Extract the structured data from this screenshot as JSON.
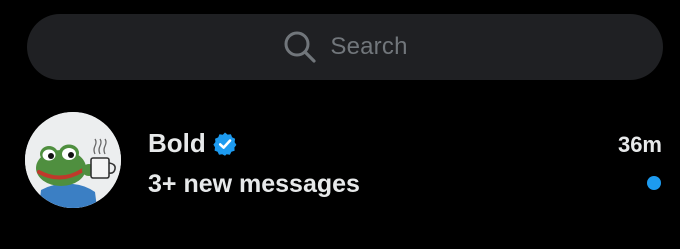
{
  "search": {
    "placeholder": "Search",
    "icon": "search-icon"
  },
  "conversation": {
    "name": "Bold",
    "verified": true,
    "verified_icon": "verified-badge-icon",
    "preview": "3+ new messages",
    "timestamp": "36m",
    "unread": true,
    "avatar": "frog-with-mug-avatar"
  },
  "colors": {
    "background": "#000000",
    "search_bg": "#1f2023",
    "placeholder": "#71767b",
    "text": "#e7e9ea",
    "accent": "#1d9bf0",
    "avatar_bg": "#eceeef"
  }
}
